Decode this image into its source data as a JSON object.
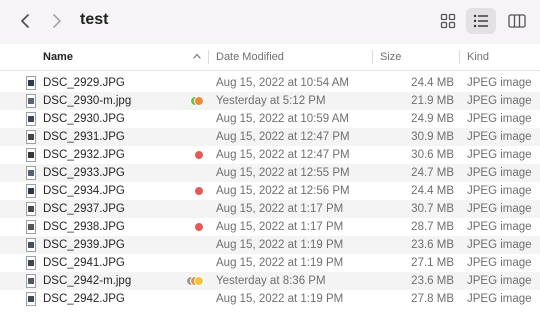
{
  "window": {
    "title": "test"
  },
  "toolbar": {
    "back_icon": "chevron-left",
    "forward_icon": "chevron-right",
    "views": [
      {
        "name": "icon-view",
        "icon": "grid-icon",
        "active": false
      },
      {
        "name": "list-view",
        "icon": "list-icon",
        "active": true
      },
      {
        "name": "column-view",
        "icon": "columns-icon",
        "active": false
      }
    ]
  },
  "columns": {
    "name": "Name",
    "date_modified": "Date Modified",
    "size": "Size",
    "kind": "Kind",
    "sort_icon": "chevron-up"
  },
  "colors": {
    "tag_green": "#62c554",
    "tag_orange": "#f0883a",
    "tag_yellow": "#f4c33b",
    "tag_red": "#e45b55",
    "tag_gray": "#9a9a9e",
    "row_alt": "#f4f4f5",
    "toolbar_bg": "#f6f4f6"
  },
  "files": [
    {
      "name": "DSC_2929.JPG",
      "date": "Aug 15, 2022 at 10:54 AM",
      "size": "24.4 MB",
      "kind": "JPEG image",
      "tags": [],
      "thumb": "#2f3a4a"
    },
    {
      "name": "DSC_2930-m.jpg",
      "date": "Yesterday at 5:12 PM",
      "size": "21.9 MB",
      "kind": "JPEG image",
      "tags": [
        "green",
        "orange"
      ],
      "thumb": "#5a6472"
    },
    {
      "name": "DSC_2930.JPG",
      "date": "Aug 15, 2022 at 10:59 AM",
      "size": "24.9 MB",
      "kind": "JPEG image",
      "tags": [],
      "thumb": "#3d4757"
    },
    {
      "name": "DSC_2931.JPG",
      "date": "Aug 15, 2022 at 12:47 PM",
      "size": "30.9 MB",
      "kind": "JPEG image",
      "tags": [],
      "thumb": "#4a4540"
    },
    {
      "name": "DSC_2932.JPG",
      "date": "Aug 15, 2022 at 12:47 PM",
      "size": "30.6 MB",
      "kind": "JPEG image",
      "tags": [
        "red"
      ],
      "thumb": "#3a3632"
    },
    {
      "name": "DSC_2933.JPG",
      "date": "Aug 15, 2022 at 12:55 PM",
      "size": "24.7 MB",
      "kind": "JPEG image",
      "tags": [],
      "thumb": "#55606e"
    },
    {
      "name": "DSC_2934.JPG",
      "date": "Aug 15, 2022 at 12:56 PM",
      "size": "24.4 MB",
      "kind": "JPEG image",
      "tags": [
        "red"
      ],
      "thumb": "#2d3644"
    },
    {
      "name": "DSC_2937.JPG",
      "date": "Aug 15, 2022 at 1:17 PM",
      "size": "30.7 MB",
      "kind": "JPEG image",
      "tags": [],
      "thumb": "#4c4945"
    },
    {
      "name": "DSC_2938.JPG",
      "date": "Aug 15, 2022 at 1:17 PM",
      "size": "28.7 MB",
      "kind": "JPEG image",
      "tags": [
        "red"
      ],
      "thumb": "#5b5550"
    },
    {
      "name": "DSC_2939.JPG",
      "date": "Aug 15, 2022 at 1:19 PM",
      "size": "23.6 MB",
      "kind": "JPEG image",
      "tags": [],
      "thumb": "#46505c"
    },
    {
      "name": "DSC_2941.JPG",
      "date": "Aug 15, 2022 at 1:19 PM",
      "size": "27.1 MB",
      "kind": "JPEG image",
      "tags": [],
      "thumb": "#3f4650"
    },
    {
      "name": "DSC_2942-m.jpg",
      "date": "Yesterday at 8:36 PM",
      "size": "23.6 MB",
      "kind": "JPEG image",
      "tags": [
        "gray",
        "orange",
        "yellow"
      ],
      "thumb": "#505864"
    },
    {
      "name": "DSC_2942.JPG",
      "date": "Aug 15, 2022 at 1:19 PM",
      "size": "27.8 MB",
      "kind": "JPEG image",
      "tags": [],
      "thumb": "#424a55"
    }
  ]
}
